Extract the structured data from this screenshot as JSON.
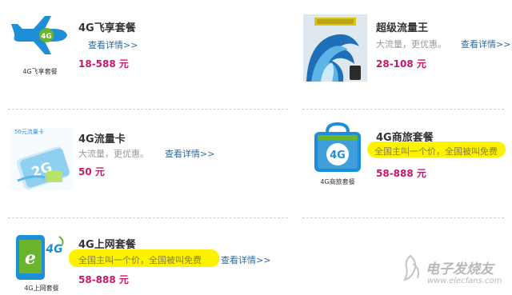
{
  "products": [
    {
      "title": "4G飞享套餐",
      "link": "查看详情>>",
      "price": "18-588 元",
      "icon_label": "4G飞享套餐",
      "icon": "airplane-icon"
    },
    {
      "title": "超级流量王",
      "desc": "大流量，更优惠。",
      "link": "查看详情>>",
      "price": "28-108 元",
      "icon": "wave-icon"
    },
    {
      "title": "4G流量卡",
      "desc": "大流量，更优惠。",
      "link": "查看详情>>",
      "price": "50 元",
      "icon": "sim-card-icon",
      "icon_badge": "50元流量卡"
    },
    {
      "title": "4G商旅套餐",
      "desc": "全国主叫一个价，全国被叫免费",
      "link": "查看详情>>",
      "price": "58-888 元",
      "icon_label": "4G商旅套餐",
      "icon": "shopping-bag-icon"
    },
    {
      "title": "4G上网套餐",
      "desc": "全国主叫一个价，全国被叫免费",
      "link": "查看详情>>",
      "price": "58-888 元",
      "icon_label": "4G上网套餐",
      "icon": "phone-4g-icon"
    }
  ],
  "watermark": {
    "name": "电子发烧友",
    "url": "www.elecfans.com"
  },
  "colors": {
    "price": "#c8176b",
    "link": "#2a6aa0",
    "highlight": "#fdf200",
    "accent_blue": "#1e8fd6",
    "accent_green": "#6ab42d"
  }
}
